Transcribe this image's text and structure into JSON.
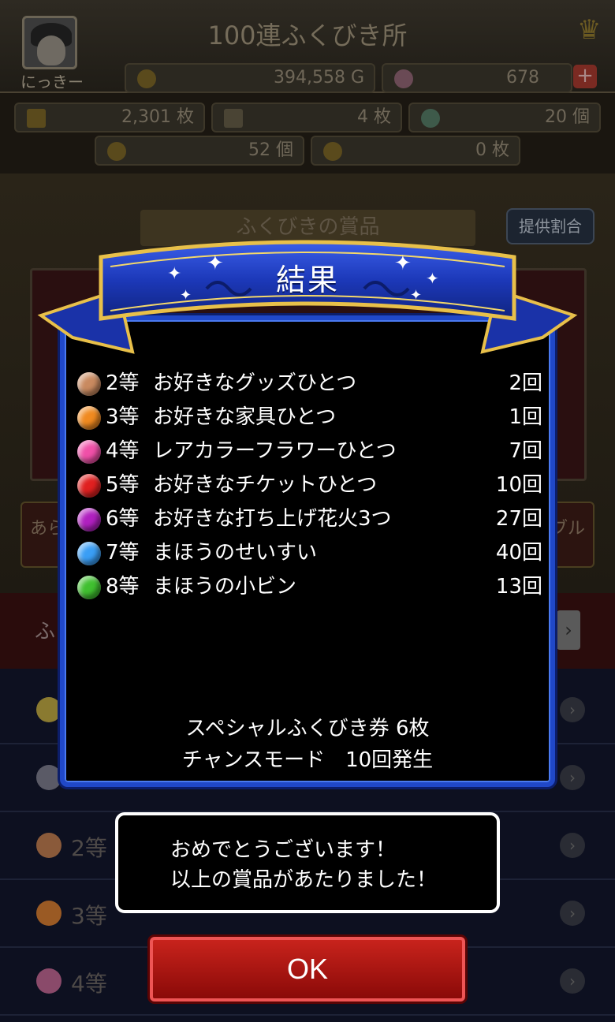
{
  "header": {
    "title": "100連ふくびき所",
    "player_name": "にっきー",
    "gold": "394,558 G",
    "gems": "678"
  },
  "resources": [
    {
      "icon": "ticket-icon",
      "value": "2,301 枚"
    },
    {
      "icon": "card-icon",
      "value": "4 枚"
    },
    {
      "icon": "rainbow-gem-icon",
      "value": "20 個"
    },
    {
      "icon": "coin-icon",
      "value": "52 個"
    },
    {
      "icon": "medal-icon",
      "value": "0 枚"
    }
  ],
  "background": {
    "prizes_tab": "ふくびきの賞品",
    "ratio_button": "提供割合",
    "left_side_button": "あら",
    "right_side_button": "ブル",
    "red_bar_label": "ふ",
    "list_rows": [
      {
        "label": "",
        "orb_color": "#8a7a30"
      },
      {
        "label": "",
        "orb_color": "#5a5a66"
      },
      {
        "label": "2等",
        "orb_color": "#8a5a3a"
      },
      {
        "label": "3等",
        "orb_color": "#9a5a24"
      },
      {
        "label": "4等",
        "orb_color": "#8a4a6a"
      }
    ]
  },
  "result": {
    "title": "結果",
    "rows": [
      {
        "rank": "2等",
        "prize": "お好きなグッズひとつ",
        "count": "2回",
        "orb_color": "#c98a60"
      },
      {
        "rank": "3等",
        "prize": "お好きな家具ひとつ",
        "count": "1回",
        "orb_color": "#f08a20"
      },
      {
        "rank": "4等",
        "prize": "レアカラーフラワーひとつ",
        "count": "7回",
        "orb_color": "#f050a8"
      },
      {
        "rank": "5等",
        "prize": "お好きなチケットひとつ",
        "count": "10回",
        "orb_color": "#e02020"
      },
      {
        "rank": "6等",
        "prize": "お好きな打ち上げ花火3つ",
        "count": "27回",
        "orb_color": "#b020c0"
      },
      {
        "rank": "7等",
        "prize": "まほうのせいすい",
        "count": "40回",
        "orb_color": "#3a9ef5"
      },
      {
        "rank": "8等",
        "prize": "まほうの小ビン",
        "count": "13回",
        "orb_color": "#40c030"
      }
    ],
    "special_ticket": "スペシャルふくびき券 6枚",
    "chance_mode": "チャンスモード　10回発生"
  },
  "message": {
    "line1": "おめでとうございます！",
    "line2": "以上の賞品があたりました！"
  },
  "ok_label": "OK",
  "colors": {
    "panel_border": "#2048c8",
    "ribbon": "#1e3fc0",
    "ok_button": "#b3160f"
  }
}
